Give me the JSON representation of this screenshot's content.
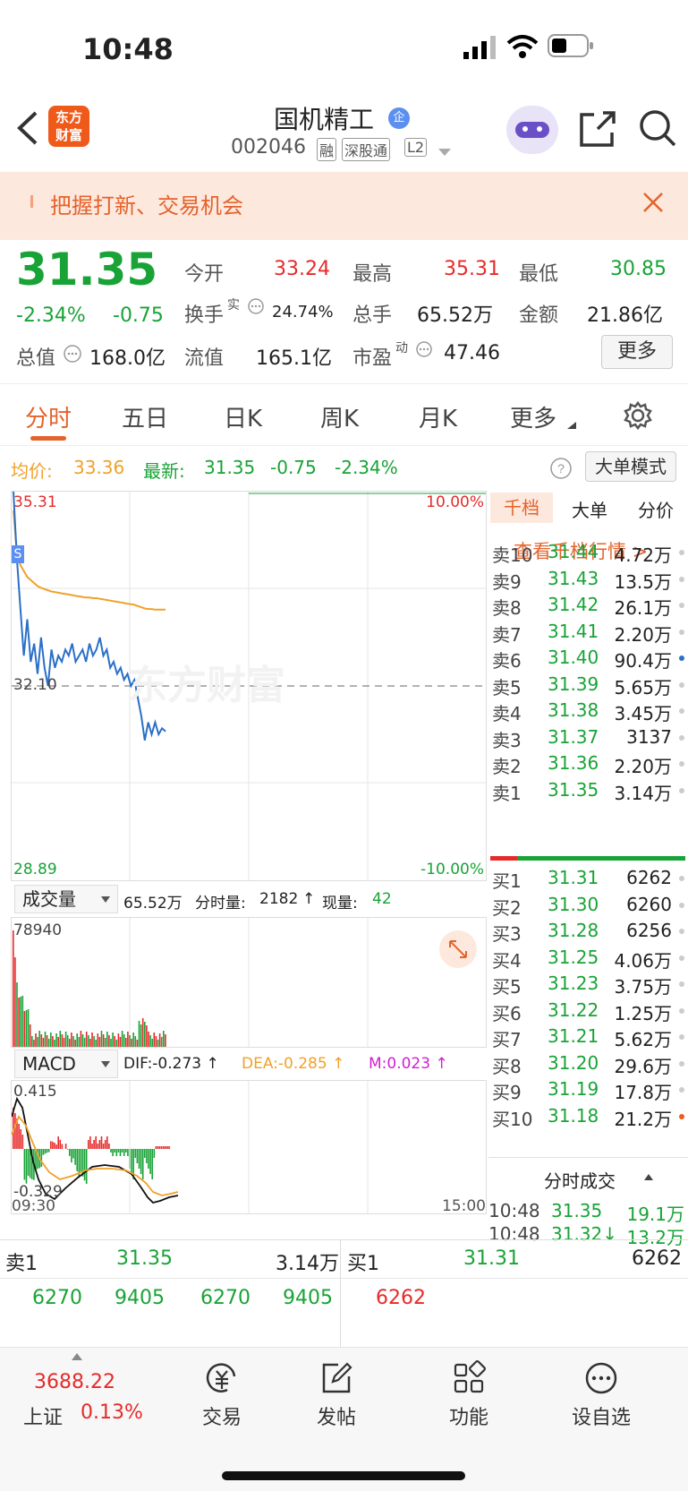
{
  "status": {
    "time": "10:48"
  },
  "nav": {
    "logo_line1": "东方",
    "logo_line2": "财富",
    "stock_name": "国机精工",
    "badge_qi": "企",
    "stock_code": "002046",
    "tag_rong": "融",
    "tag_connect": "深股通",
    "tag_l2": "L2"
  },
  "banner": {
    "text": "把握打新、交易机会"
  },
  "quote": {
    "price": "31.35",
    "change_pct": "-2.34%",
    "change": "-0.75",
    "open_label": "今开",
    "open": "33.24",
    "high_label": "最高",
    "high": "35.31",
    "low_label": "最低",
    "low": "30.85",
    "turnover_label": "换手",
    "turnover_sup": "实",
    "turnover": "24.74%",
    "volume_label": "总手",
    "volume": "65.52万",
    "amount_label": "金额",
    "amount": "21.86亿",
    "mktcap_label": "总值",
    "mktcap": "168.0亿",
    "float_label": "流值",
    "float": "165.1亿",
    "pe_label": "市盈",
    "pe_sup": "动",
    "pe": "47.46",
    "more_label": "更多"
  },
  "tabs": [
    "分时",
    "五日",
    "日K",
    "周K",
    "月K",
    "更多"
  ],
  "info_line": {
    "avg_label": "均价:",
    "avg": "33.36",
    "latest_label": "最新:",
    "latest": "31.35",
    "chg": "-0.75",
    "chg_pct": "-2.34%",
    "mode_label": "大单模式"
  },
  "chart": {
    "y_high": "35.31",
    "y_mid": "32.10",
    "y_low": "28.89",
    "pct_high": "10.00%",
    "pct_low": "-10.00%",
    "watermark": "东方财富",
    "s_marker": "S",
    "time_start": "09:30",
    "time_end": "15:00"
  },
  "chart_data": {
    "type": "line",
    "prev_close": 32.1,
    "ylim": [
      28.89,
      35.31
    ],
    "series": [
      {
        "values": [
          35.31,
          34.2,
          33.4,
          32.6,
          33.2,
          32.5,
          32.8,
          32.3,
          32.9,
          32.4,
          32.1,
          32.7,
          32.4,
          32.6,
          32.5,
          32.7,
          32.6,
          32.8,
          32.5,
          32.6,
          32.7,
          32.5,
          32.8,
          32.6,
          32.7,
          32.9,
          32.6,
          32.7,
          32.4,
          32.5,
          32.3,
          32.4,
          32.2,
          32.3,
          32.1,
          32.2,
          31.9,
          31.6,
          31.2,
          31.5,
          31.3,
          31.5,
          31.3,
          31.4,
          31.35
        ]
      },
      {
        "values": [
          35.0,
          34.3,
          34.1,
          34.0,
          33.9,
          33.85,
          33.8,
          33.75,
          33.72,
          33.7,
          33.68,
          33.66,
          33.65,
          33.64,
          33.63,
          33.62,
          33.61,
          33.6,
          33.59,
          33.58,
          33.57,
          33.56,
          33.56,
          33.55,
          33.55,
          33.54,
          33.53,
          33.52,
          33.51,
          33.5,
          33.49,
          33.48,
          33.47,
          33.46,
          33.45,
          33.44,
          33.42,
          33.4,
          33.38,
          33.37,
          33.37,
          33.36,
          33.36,
          33.36,
          33.36
        ]
      }
    ]
  },
  "volume": {
    "select_label": "成交量",
    "total": "65.52万",
    "tick_label": "分时量:",
    "tick_value": "2182",
    "now_label": "现量:",
    "now_value": "42",
    "y_max": "78940"
  },
  "macd": {
    "select_label": "MACD",
    "dif": "DIF:-0.273",
    "dea": "DEA:-0.285",
    "m": "M:0.023",
    "y_top": "0.415",
    "y_bottom": "-0.329"
  },
  "panel_tabs": [
    "千档",
    "大单",
    "分价"
  ],
  "panel_link": "查看千档行情 >",
  "asks": [
    {
      "label": "卖10",
      "price": "31.44",
      "vol": "4.72万"
    },
    {
      "label": "卖9",
      "price": "31.43",
      "vol": "13.5万"
    },
    {
      "label": "卖8",
      "price": "31.42",
      "vol": "26.1万"
    },
    {
      "label": "卖7",
      "price": "31.41",
      "vol": "2.20万"
    },
    {
      "label": "卖6",
      "price": "31.40",
      "vol": "90.4万"
    },
    {
      "label": "卖5",
      "price": "31.39",
      "vol": "5.65万"
    },
    {
      "label": "卖4",
      "price": "31.38",
      "vol": "3.45万"
    },
    {
      "label": "卖3",
      "price": "31.37",
      "vol": "3137"
    },
    {
      "label": "卖2",
      "price": "31.36",
      "vol": "2.20万"
    },
    {
      "label": "卖1",
      "price": "31.35",
      "vol": "3.14万"
    }
  ],
  "bids": [
    {
      "label": "买1",
      "price": "31.31",
      "vol": "6262"
    },
    {
      "label": "买2",
      "price": "31.30",
      "vol": "6260"
    },
    {
      "label": "买3",
      "price": "31.28",
      "vol": "6256"
    },
    {
      "label": "买4",
      "price": "31.25",
      "vol": "4.06万"
    },
    {
      "label": "买5",
      "price": "31.23",
      "vol": "3.75万"
    },
    {
      "label": "买6",
      "price": "31.22",
      "vol": "1.25万"
    },
    {
      "label": "买7",
      "price": "31.21",
      "vol": "5.62万"
    },
    {
      "label": "买8",
      "price": "31.20",
      "vol": "29.6万"
    },
    {
      "label": "买9",
      "price": "31.19",
      "vol": "17.8万"
    },
    {
      "label": "买10",
      "price": "31.18",
      "vol": "21.2万"
    }
  ],
  "ticks_header": "分时成交",
  "ticks": [
    {
      "time": "10:48",
      "price": "31.35",
      "vol": "19.1万"
    },
    {
      "time": "10:48",
      "price": "31.32↓",
      "vol": "13.2万"
    }
  ],
  "bottom_ob": {
    "sell_label": "卖1",
    "sell_price": "31.35",
    "sell_vol": "3.14万",
    "buy_label": "买1",
    "buy_price": "31.31",
    "buy_vol": "6262",
    "sell_detail": [
      "6270",
      "9405",
      "6270",
      "9405"
    ],
    "buy_detail": [
      "6262"
    ]
  },
  "tabbar": {
    "index_value": "3688.22",
    "index_name": "上证",
    "index_pct": "0.13%",
    "trade": "交易",
    "post": "发帖",
    "func": "功能",
    "watch": "设自选"
  }
}
